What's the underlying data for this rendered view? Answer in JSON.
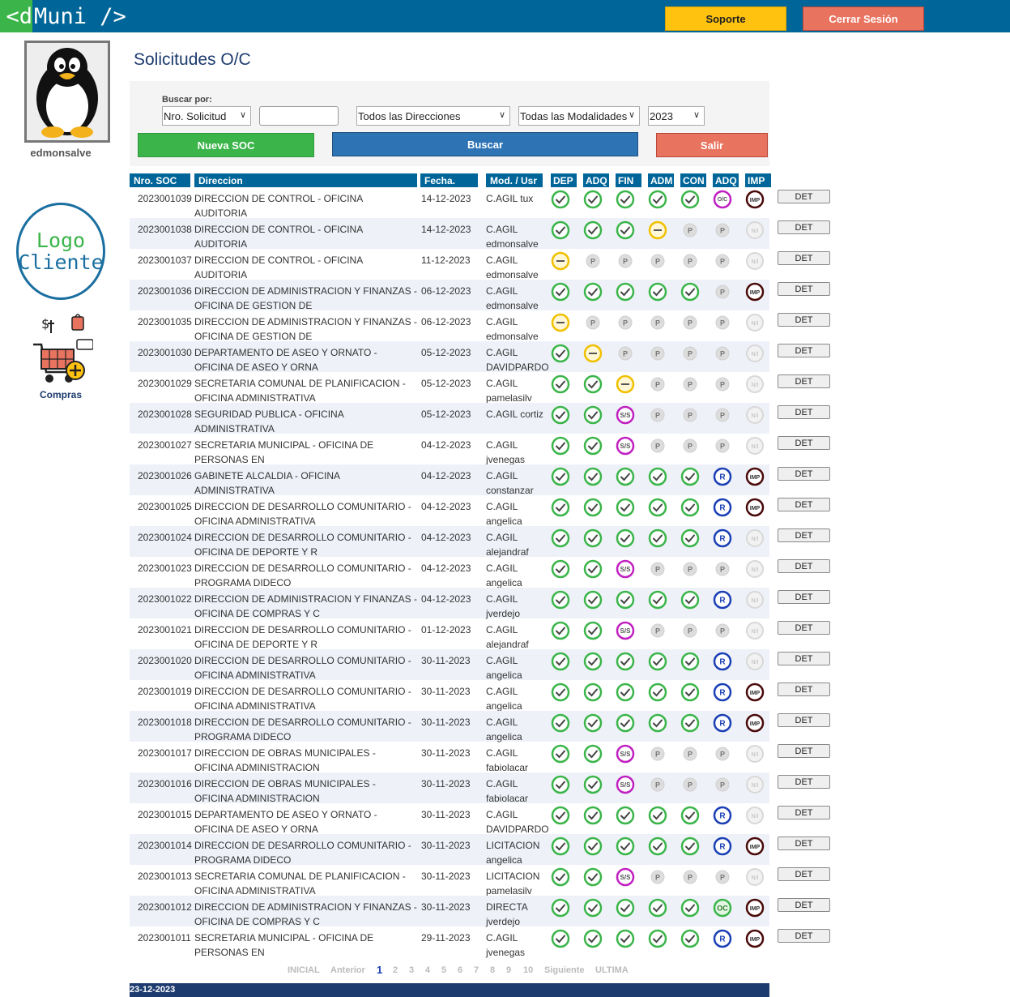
{
  "brand": {
    "tag": "<d",
    "name": "Muni />"
  },
  "top_buttons": {
    "soporte": "Soporte",
    "cerrar": "Cerrar Sesión"
  },
  "user": {
    "name": "edmonsalve"
  },
  "logo_cliente": {
    "line1": "Logo",
    "line2": "Cliente"
  },
  "compras": {
    "label": "Compras"
  },
  "page_title": "Solicitudes O/C",
  "filters": {
    "buscar_label": "Buscar por:",
    "buscar_por": "Nro. Solicitud",
    "search_value": "",
    "direcciones": "Todos las Direcciones",
    "modalidades": "Todas las Modalidades",
    "year": "2023",
    "nueva_label": "Nueva SOC",
    "buscar_label_btn": "Buscar",
    "salir_label": "Salir"
  },
  "table": {
    "headers": [
      "Nro. SOC",
      "Direccion",
      "Fecha.",
      "Mod. / Usr",
      "DEP",
      "ADQ",
      "FIN",
      "ADM",
      "CON",
      "ADQ",
      "IMP"
    ],
    "det_label": "DET",
    "status_labels": {
      "P": "P",
      "NI": "N/I",
      "SS": "S/S",
      "R": "R",
      "IMP": "IMP",
      "OC": "OC",
      "OCA": "O/C"
    },
    "rows": [
      {
        "num": "2023001039",
        "dir": "DIRECCION DE CONTROL - OFICINA AUDITORIA",
        "fecha": "14-12-2023",
        "mod": "C.AGIL tux",
        "st": [
          "ok",
          "ok",
          "ok",
          "ok",
          "ok",
          "oca",
          "imp"
        ]
      },
      {
        "num": "2023001038",
        "dir": "DIRECCION DE CONTROL - OFICINA AUDITORIA",
        "fecha": "14-12-2023",
        "mod": "C.AGIL edmonsalve",
        "st": [
          "ok",
          "ok",
          "ok",
          "pend",
          "p",
          "p",
          "ni"
        ]
      },
      {
        "num": "2023001037",
        "dir": "DIRECCION DE CONTROL - OFICINA AUDITORIA",
        "fecha": "11-12-2023",
        "mod": "C.AGIL edmonsalve",
        "st": [
          "pend",
          "p",
          "p",
          "p",
          "p",
          "p",
          "ni"
        ]
      },
      {
        "num": "2023001036",
        "dir": "DIRECCION DE ADMINISTRACION Y FINANZAS - OFICINA DE GESTION DE",
        "fecha": "06-12-2023",
        "mod": "C.AGIL edmonsalve",
        "st": [
          "ok",
          "ok",
          "ok",
          "ok",
          "ok",
          "p",
          "imp"
        ]
      },
      {
        "num": "2023001035",
        "dir": "DIRECCION DE ADMINISTRACION Y FINANZAS - OFICINA DE GESTION DE",
        "fecha": "06-12-2023",
        "mod": "C.AGIL edmonsalve",
        "st": [
          "pend",
          "p",
          "p",
          "p",
          "p",
          "p",
          "ni"
        ]
      },
      {
        "num": "2023001030",
        "dir": "DEPARTAMENTO DE ASEO Y ORNATO - OFICINA DE ASEO Y ORNA",
        "fecha": "05-12-2023",
        "mod": "C.AGIL DAVIDPARDO",
        "st": [
          "ok",
          "pend",
          "p",
          "p",
          "p",
          "p",
          "ni"
        ]
      },
      {
        "num": "2023001029",
        "dir": "SECRETARIA COMUNAL DE PLANIFICACION - OFICINA ADMINISTRATIVA",
        "fecha": "05-12-2023",
        "mod": "C.AGIL pamelasilv",
        "st": [
          "ok",
          "ok",
          "pend",
          "p",
          "p",
          "p",
          "ni"
        ]
      },
      {
        "num": "2023001028",
        "dir": "SEGURIDAD PUBLICA - OFICINA ADMINISTRATIVA",
        "fecha": "05-12-2023",
        "mod": "C.AGIL cortiz",
        "st": [
          "ok",
          "ok",
          "ss",
          "p",
          "p",
          "p",
          "ni"
        ]
      },
      {
        "num": "2023001027",
        "dir": "SECRETARIA MUNICIPAL - OFICINA DE PERSONAS EN",
        "fecha": "04-12-2023",
        "mod": "C.AGIL jvenegas",
        "st": [
          "ok",
          "ok",
          "ss",
          "p",
          "p",
          "p",
          "ni"
        ]
      },
      {
        "num": "2023001026",
        "dir": "GABINETE ALCALDIA - OFICINA ADMINISTRATIVA",
        "fecha": "04-12-2023",
        "mod": "C.AGIL constanzar",
        "st": [
          "ok",
          "ok",
          "ok",
          "ok",
          "ok",
          "r",
          "imp"
        ]
      },
      {
        "num": "2023001025",
        "dir": "DIRECCION DE DESARROLLO COMUNITARIO - OFICINA ADMINISTRATIVA",
        "fecha": "04-12-2023",
        "mod": "C.AGIL angelica",
        "st": [
          "ok",
          "ok",
          "ok",
          "ok",
          "ok",
          "r",
          "imp"
        ]
      },
      {
        "num": "2023001024",
        "dir": "DIRECCION DE DESARROLLO COMUNITARIO - OFICINA DE DEPORTE Y R",
        "fecha": "04-12-2023",
        "mod": "C.AGIL alejandraf",
        "st": [
          "ok",
          "ok",
          "ok",
          "ok",
          "ok",
          "r",
          "ni"
        ]
      },
      {
        "num": "2023001023",
        "dir": "DIRECCION DE DESARROLLO COMUNITARIO - PROGRAMA DIDECO",
        "fecha": "04-12-2023",
        "mod": "C.AGIL angelica",
        "st": [
          "ok",
          "ok",
          "ss",
          "p",
          "p",
          "p",
          "ni"
        ]
      },
      {
        "num": "2023001022",
        "dir": "DIRECCION DE ADMINISTRACION Y FINANZAS - OFICINA DE COMPRAS Y C",
        "fecha": "04-12-2023",
        "mod": "C.AGIL jverdejo",
        "st": [
          "ok",
          "ok",
          "ok",
          "ok",
          "ok",
          "r",
          "ni"
        ]
      },
      {
        "num": "2023001021",
        "dir": "DIRECCION DE DESARROLLO COMUNITARIO - OFICINA DE DEPORTE Y R",
        "fecha": "01-12-2023",
        "mod": "C.AGIL alejandraf",
        "st": [
          "ok",
          "ok",
          "ss",
          "p",
          "p",
          "p",
          "ni"
        ]
      },
      {
        "num": "2023001020",
        "dir": "DIRECCION DE DESARROLLO COMUNITARIO - OFICINA ADMINISTRATIVA",
        "fecha": "30-11-2023",
        "mod": "C.AGIL angelica",
        "st": [
          "ok",
          "ok",
          "ok",
          "ok",
          "ok",
          "r",
          "ni"
        ]
      },
      {
        "num": "2023001019",
        "dir": "DIRECCION DE DESARROLLO COMUNITARIO - OFICINA ADMINISTRATIVA",
        "fecha": "30-11-2023",
        "mod": "C.AGIL angelica",
        "st": [
          "ok",
          "ok",
          "ok",
          "ok",
          "ok",
          "r",
          "imp"
        ]
      },
      {
        "num": "2023001018",
        "dir": "DIRECCION DE DESARROLLO COMUNITARIO - PROGRAMA DIDECO",
        "fecha": "30-11-2023",
        "mod": "C.AGIL angelica",
        "st": [
          "ok",
          "ok",
          "ok",
          "ok",
          "ok",
          "r",
          "imp"
        ]
      },
      {
        "num": "2023001017",
        "dir": "DIRECCION DE OBRAS MUNICIPALES - OFICINA ADMINISTRACION",
        "fecha": "30-11-2023",
        "mod": "C.AGIL fabiolacar",
        "st": [
          "ok",
          "ok",
          "ss",
          "p",
          "p",
          "p",
          "ni"
        ]
      },
      {
        "num": "2023001016",
        "dir": "DIRECCION DE OBRAS MUNICIPALES - OFICINA ADMINISTRACION",
        "fecha": "30-11-2023",
        "mod": "C.AGIL fabiolacar",
        "st": [
          "ok",
          "ok",
          "ss",
          "p",
          "p",
          "p",
          "ni"
        ]
      },
      {
        "num": "2023001015",
        "dir": "DEPARTAMENTO DE ASEO Y ORNATO - OFICINA DE ASEO Y ORNA",
        "fecha": "30-11-2023",
        "mod": "C.AGIL DAVIDPARDO",
        "st": [
          "ok",
          "ok",
          "ok",
          "ok",
          "ok",
          "r",
          "ni"
        ]
      },
      {
        "num": "2023001014",
        "dir": "DIRECCION DE DESARROLLO COMUNITARIO - PROGRAMA DIDECO",
        "fecha": "30-11-2023",
        "mod": "LICITACION angelica",
        "st": [
          "ok",
          "ok",
          "ok",
          "ok",
          "ok",
          "r",
          "imp"
        ]
      },
      {
        "num": "2023001013",
        "dir": "SECRETARIA COMUNAL DE PLANIFICACION - OFICINA ADMINISTRATIVA",
        "fecha": "30-11-2023",
        "mod": "LICITACION pamelasilv",
        "st": [
          "ok",
          "ok",
          "ss",
          "p",
          "p",
          "p",
          "ni"
        ]
      },
      {
        "num": "2023001012",
        "dir": "DIRECCION DE ADMINISTRACION Y FINANZAS - OFICINA DE COMPRAS Y C",
        "fecha": "30-11-2023",
        "mod": "DIRECTA jverdejo",
        "st": [
          "ok",
          "ok",
          "ok",
          "ok",
          "ok",
          "oc",
          "imp"
        ]
      },
      {
        "num": "2023001011",
        "dir": "SECRETARIA MUNICIPAL - OFICINA DE PERSONAS EN",
        "fecha": "29-11-2023",
        "mod": "C.AGIL jvenegas",
        "st": [
          "ok",
          "ok",
          "ok",
          "ok",
          "ok",
          "r",
          "imp"
        ]
      }
    ]
  },
  "pager": {
    "inicial": "INICIAL",
    "anterior": "Anterior",
    "pages": [
      "1",
      "2",
      "3",
      "4",
      "5",
      "6",
      "7",
      "8",
      "9",
      "10"
    ],
    "current": "1",
    "siguiente": "Siguiente",
    "ultima": "ULTIMA"
  },
  "footer": {
    "date": "23-12-2023"
  },
  "colors": {
    "topbar": "#006699",
    "green": "#3bb54a",
    "blue": "#2e74b5",
    "yellow": "#ffc20e",
    "salmon": "#e8735f",
    "navy": "#1d3b6e",
    "ok": "#3bb54a",
    "ss": "#c020c0",
    "r": "#1b3fb5",
    "imp": "#4a0a0a",
    "pend": "#f2c000"
  }
}
